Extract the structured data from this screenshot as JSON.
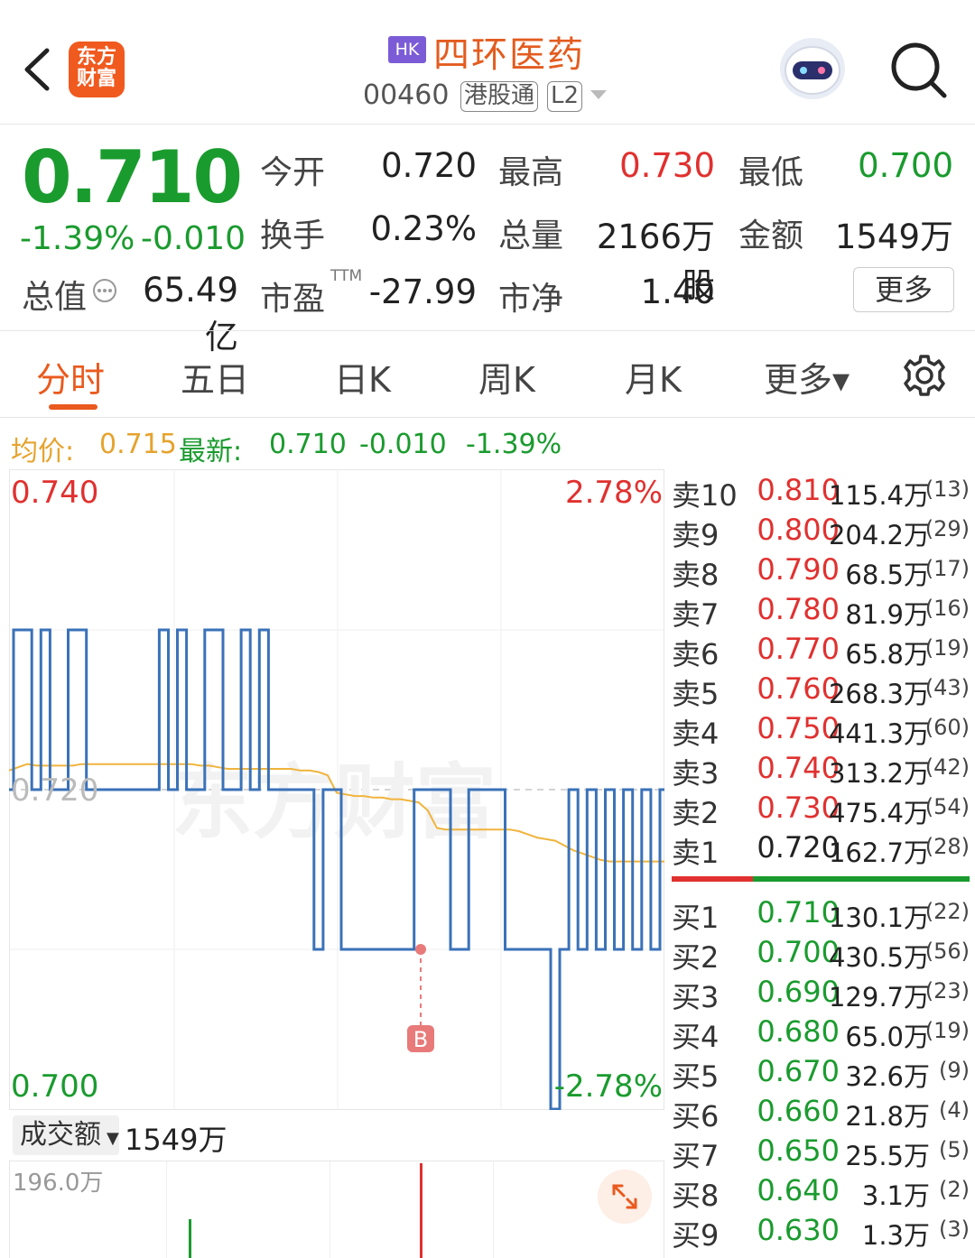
{
  "header": {
    "logo_text": "东方\n财富",
    "market_badge": "HK",
    "stock_name": "四环医药",
    "stock_code": "00460",
    "tag_connect": "港股通",
    "tag_level": "L2"
  },
  "quote": {
    "price": "0.710",
    "change_pct": "-1.39%",
    "change_abs": "-0.010",
    "market_cap_label": "总值",
    "market_cap": "65.49亿",
    "open_label": "今开",
    "open": "0.720",
    "high_label": "最高",
    "high": "0.730",
    "low_label": "最低",
    "low": "0.700",
    "turnover_label": "换手",
    "turnover": "0.23%",
    "volume_label": "总量",
    "volume": "2166万股",
    "amount_label": "金额",
    "amount": "1549万",
    "pe_label": "市盈",
    "pe_sup": "TTM",
    "pe": "-27.99",
    "pb_label": "市净",
    "pb": "1.40",
    "more_label": "更多"
  },
  "tabs": [
    {
      "label": "分时",
      "active": true
    },
    {
      "label": "五日"
    },
    {
      "label": "日K"
    },
    {
      "label": "周K"
    },
    {
      "label": "月K"
    },
    {
      "label": "更多▾"
    }
  ],
  "info_line": {
    "avg_label": "均价:",
    "avg": "0.715",
    "latest_label": "最新:",
    "latest": "0.710",
    "change_abs": "-0.010",
    "change_pct": "-1.39%"
  },
  "chart": {
    "y_top": "0.740",
    "y_mid": "0.720",
    "y_bottom": "0.700",
    "pct_top": "2.78%",
    "pct_bottom": "-2.78%",
    "marker": "B",
    "watermark": "东方财富"
  },
  "chart_data": {
    "type": "line",
    "ylim": [
      0.7,
      0.74
    ],
    "prev_close": 0.72,
    "series": [
      {
        "values": [
          0.72,
          0.73,
          0.73,
          0.72,
          0.73,
          0.72,
          0.72,
          0.73,
          0.73,
          0.72,
          0.72,
          0.72,
          0.72,
          0.72,
          0.72,
          0.72,
          0.72,
          0.73,
          0.72,
          0.73,
          0.72,
          0.72,
          0.73,
          0.73,
          0.72,
          0.72,
          0.73,
          0.72,
          0.73,
          0.72,
          0.72,
          0.72,
          0.72,
          0.72,
          0.71,
          0.72,
          0.72,
          0.71,
          0.71,
          0.71,
          0.71,
          0.71,
          0.71,
          0.71,
          0.71,
          0.72,
          0.72,
          0.72,
          0.72,
          0.71,
          0.71,
          0.72,
          0.72,
          0.72,
          0.72,
          0.71,
          0.71,
          0.71,
          0.71,
          0.71,
          0.7,
          0.71,
          0.72,
          0.71,
          0.72,
          0.71,
          0.72,
          0.71,
          0.72,
          0.71,
          0.72,
          0.71,
          0.72
        ]
      },
      {
        "values": [
          0.7212,
          0.7214,
          0.7216,
          0.7215,
          0.7215,
          0.7215,
          0.7215,
          0.7215,
          0.7216,
          0.7216,
          0.7216,
          0.7216,
          0.7216,
          0.7216,
          0.7216,
          0.7216,
          0.7216,
          0.7216,
          0.7216,
          0.7216,
          0.7216,
          0.7215,
          0.7215,
          0.7214,
          0.7213,
          0.7213,
          0.7213,
          0.7213,
          0.7213,
          0.7213,
          0.7213,
          0.7213,
          0.7212,
          0.7212,
          0.7211,
          0.7209,
          0.7198,
          0.7197,
          0.7196,
          0.7196,
          0.7195,
          0.7195,
          0.7194,
          0.7194,
          0.7193,
          0.7192,
          0.7187,
          0.7176,
          0.7175,
          0.7175,
          0.7175,
          0.7175,
          0.7175,
          0.7175,
          0.7175,
          0.7175,
          0.7174,
          0.7172,
          0.717,
          0.7169,
          0.7168,
          0.7165,
          0.7162,
          0.716,
          0.7158,
          0.7156,
          0.7155,
          0.7155,
          0.7155,
          0.7155,
          0.7155,
          0.7155,
          0.7155
        ]
      }
    ]
  },
  "order_book": {
    "asks": [
      {
        "label": "卖10",
        "price": "0.810",
        "volume": "115.4万",
        "count": "(13)"
      },
      {
        "label": "卖9",
        "price": "0.800",
        "volume": "204.2万",
        "count": "(29)"
      },
      {
        "label": "卖8",
        "price": "0.790",
        "volume": "68.5万",
        "count": "(17)"
      },
      {
        "label": "卖7",
        "price": "0.780",
        "volume": "81.9万",
        "count": "(16)"
      },
      {
        "label": "卖6",
        "price": "0.770",
        "volume": "65.8万",
        "count": "(19)"
      },
      {
        "label": "卖5",
        "price": "0.760",
        "volume": "268.3万",
        "count": "(43)"
      },
      {
        "label": "卖4",
        "price": "0.750",
        "volume": "441.3万",
        "count": "(60)"
      },
      {
        "label": "卖3",
        "price": "0.740",
        "volume": "313.2万",
        "count": "(42)"
      },
      {
        "label": "卖2",
        "price": "0.730",
        "volume": "475.4万",
        "count": "(54)"
      },
      {
        "label": "卖1",
        "price": "0.720",
        "volume": "162.7万",
        "count": "(28)"
      }
    ],
    "bids": [
      {
        "label": "买1",
        "price": "0.710",
        "volume": "130.1万",
        "count": "(22)"
      },
      {
        "label": "买2",
        "price": "0.700",
        "volume": "430.5万",
        "count": "(56)"
      },
      {
        "label": "买3",
        "price": "0.690",
        "volume": "129.7万",
        "count": "(23)"
      },
      {
        "label": "买4",
        "price": "0.680",
        "volume": "65.0万",
        "count": "(19)"
      },
      {
        "label": "买5",
        "price": "0.670",
        "volume": "32.6万",
        "count": "(9)"
      },
      {
        "label": "买6",
        "price": "0.660",
        "volume": "21.8万",
        "count": "(4)"
      },
      {
        "label": "买7",
        "price": "0.650",
        "volume": "25.5万",
        "count": "(5)"
      },
      {
        "label": "买8",
        "price": "0.640",
        "volume": "3.1万",
        "count": "(2)"
      },
      {
        "label": "买9",
        "price": "0.630",
        "volume": "1.3万",
        "count": "(3)"
      }
    ]
  },
  "volume_panel": {
    "selector_label": "成交额",
    "value": "1549万",
    "max_label": "196.0万"
  },
  "colors": {
    "up": "#e0312f",
    "down": "#1a9b2e",
    "price_line": "#3a72b8",
    "avg_line": "#f0b43c",
    "accent": "#ea5a1e"
  }
}
